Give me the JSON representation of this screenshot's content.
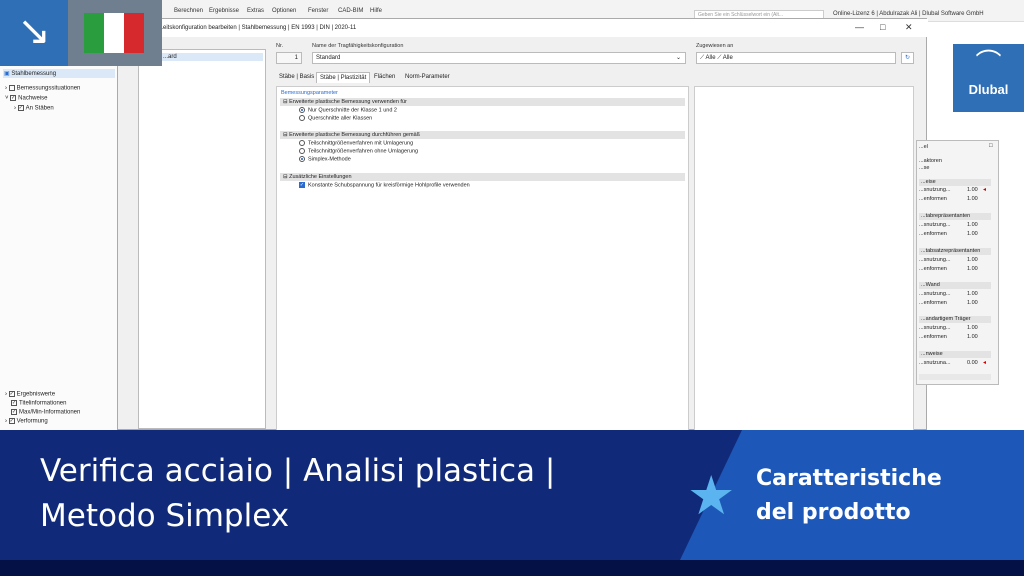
{
  "menubar": {
    "items": [
      "Berechnen",
      "Ergebnisse",
      "Extras",
      "Optionen",
      "Fenster",
      "CAD-BIM",
      "Hilfe"
    ],
    "search_placeholder": "Geben Sie ein Schlüsselwort ein (Alt...",
    "license": "Online-Lizenz 6 | Abdulrazak Ali | Dlubal Software GmbH"
  },
  "dialog": {
    "title": "...eitskonfiguration bearbeiten | Stahlbemessung | EN 1993 | DIN | 2020-11",
    "list_item": "...ard",
    "nr_label": "Nr.",
    "nr_value": "1",
    "name_label": "Name der Tragfähigkeitskonfiguration",
    "name_value": "Standard",
    "assigned_label": "Zugewiesen an",
    "assigned_a": "Alle",
    "assigned_b": "Alle",
    "tabs": [
      "Stäbe | Basis",
      "Stäbe | Plastizität",
      "Flächen",
      "Norm-Parameter"
    ],
    "params_header": "Bemessungsparameter",
    "sections": [
      {
        "title": "Erweiterte plastische Bemessung verwenden für",
        "options": [
          "Nur Querschnitte der Klasse 1 und 2",
          "Querschnitte aller Klassen"
        ]
      },
      {
        "title": "Erweiterte plastische Bemessung durchführen gemäß",
        "options": [
          "Teilschnittgrößenverfahren mit Umlagerung",
          "Teilschnittgrößenverfahren ohne Umlagerung",
          "Simplex-Methode"
        ]
      },
      {
        "title": "Zusätzliche Einstellungen",
        "options": [
          "Konstante Schubspannung für kreisförmige Hohlprofile verwenden"
        ]
      }
    ]
  },
  "navigator": {
    "root": "Stahlbemessung",
    "items": [
      "Bemessungssituationen",
      "Nachweise",
      "An Stäben"
    ],
    "bottom_items": [
      "Ergebniswerte",
      "Titelinformationen",
      "Max/Min-Informationen",
      "Verformung"
    ]
  },
  "results": {
    "title": "...el",
    "intro": [
      "...aktoren",
      "...se"
    ],
    "groups": [
      {
        "head": "...eise",
        "rows": [
          [
            "...snutzung...",
            "1.00"
          ],
          [
            "...enformen",
            "1.00"
          ]
        ]
      },
      {
        "head": "...tabrepräsentanten",
        "rows": [
          [
            "...snutzung...",
            "1.00"
          ],
          [
            "...enformen",
            "1.00"
          ]
        ]
      },
      {
        "head": "...tabsatzrepräsentanten",
        "rows": [
          [
            "...snutzung...",
            "1.00"
          ],
          [
            "...enformen",
            "1.00"
          ]
        ]
      },
      {
        "head": "...Wand",
        "rows": [
          [
            "...snutzung...",
            "1.00"
          ],
          [
            "...enformen",
            "1.00"
          ]
        ]
      },
      {
        "head": "...andartigem Träger",
        "rows": [
          [
            "...snutzung...",
            "1.00"
          ],
          [
            "...enformen",
            "1.00"
          ]
        ]
      },
      {
        "head": "...nweise",
        "rows": [
          [
            "...snutzuna...",
            "0.00"
          ]
        ]
      }
    ]
  },
  "banner": {
    "title_line1": "Verifica acciaio | Analisi plastica |",
    "title_line2": "Metodo Simplex",
    "feature_line1": "Caratteristiche",
    "feature_line2": "del prodotto"
  },
  "logo": {
    "text": "Dlubal"
  },
  "colors": {
    "banner": "#102a79",
    "feature": "#1d57b8",
    "badge": "#2f6fb5",
    "accent": "#2a6bd0"
  }
}
